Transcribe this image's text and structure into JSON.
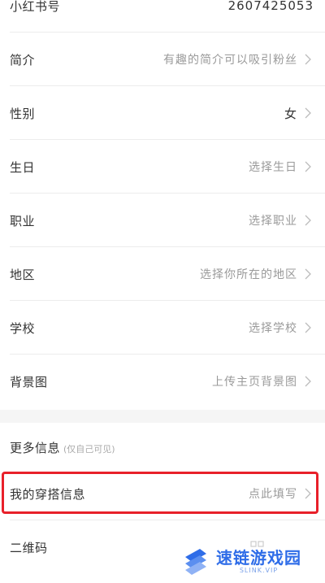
{
  "rows": [
    {
      "label": "小红书号",
      "value": "2607425053"
    },
    {
      "label": "简介",
      "value": "有趣的简介可以吸引粉丝"
    },
    {
      "label": "性别",
      "value": "女"
    },
    {
      "label": "生日",
      "value": "选择生日"
    },
    {
      "label": "职业",
      "value": "选择职业"
    },
    {
      "label": "地区",
      "value": "选择你所在的地区"
    },
    {
      "label": "学校",
      "value": "选择学校"
    },
    {
      "label": "背景图",
      "value": "上传主页背景图"
    }
  ],
  "more_section": {
    "title": "更多信息",
    "subtitle": "(仅自己可见)"
  },
  "outfit_row": {
    "label": "我的穿搭信息",
    "value": "点此填写"
  },
  "qr_row": {
    "label": "二维码"
  },
  "watermark": {
    "main": "速链游戏园",
    "sub": "SLINK.VIP"
  },
  "colors": {
    "highlight": "#e8202a",
    "watermark": "#2f6de8"
  },
  "icons": [
    "chevron-right-icon",
    "qr-code-icon",
    "watermark-logo-icon"
  ]
}
